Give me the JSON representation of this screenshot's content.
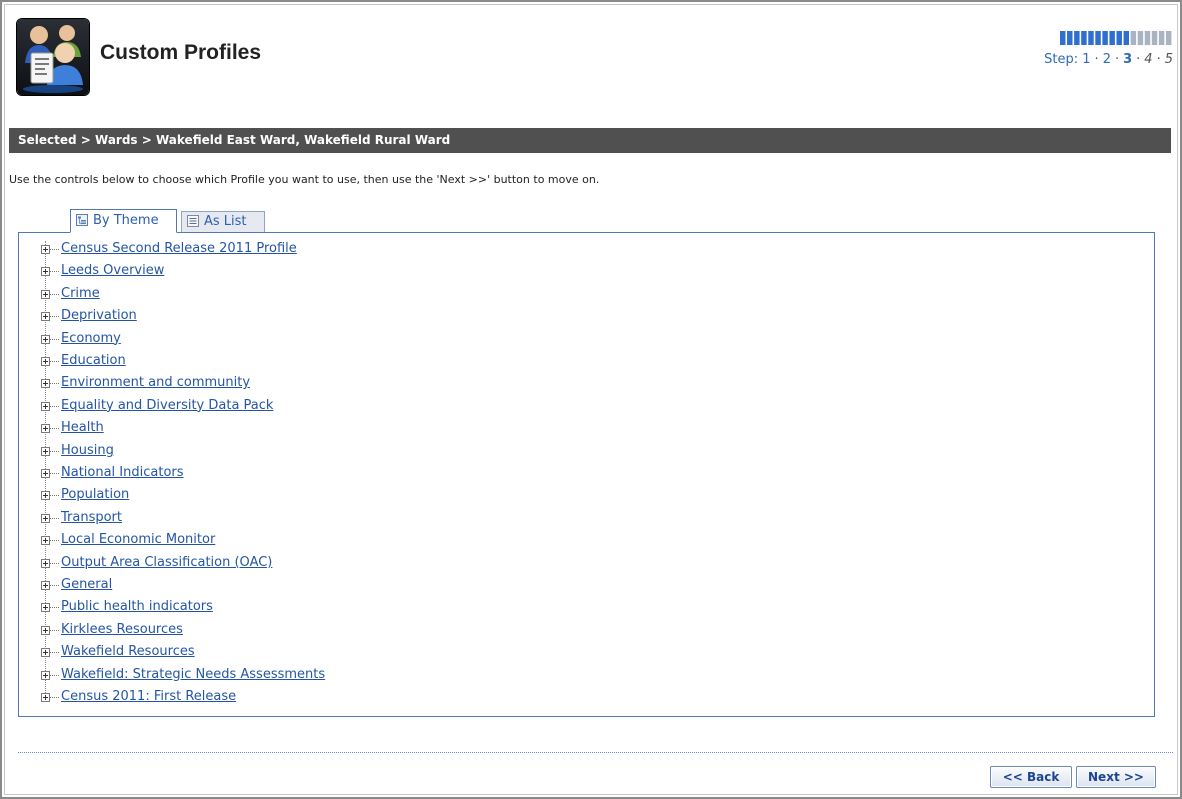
{
  "header": {
    "title": "Custom Profiles",
    "progress": {
      "filled": 10,
      "total": 16
    },
    "step_label": "Step:",
    "steps": [
      {
        "label": "1",
        "state": "done"
      },
      {
        "label": "2",
        "state": "done"
      },
      {
        "label": "3",
        "state": "current"
      },
      {
        "label": "4",
        "state": "future"
      },
      {
        "label": "5",
        "state": "future"
      }
    ]
  },
  "breadcrumb": "Selected > Wards > Wakefield East Ward, Wakefield Rural Ward",
  "instructions": "Use the controls below to choose which Profile you want to use, then use the 'Next >>' button to move on.",
  "tabs": [
    {
      "label": "By Theme",
      "active": true,
      "icon": "tree-icon"
    },
    {
      "label": "As List",
      "active": false,
      "icon": "list-icon"
    }
  ],
  "tree": [
    "Census Second Release 2011 Profile",
    "Leeds Overview",
    "Crime",
    "Deprivation",
    "Economy",
    "Education",
    "Environment and community",
    "Equality and Diversity Data Pack",
    "Health",
    "Housing",
    "National Indicators",
    "Population",
    "Transport",
    "Local Economic Monitor",
    "Output Area Classification (OAC)",
    "General",
    "Public health indicators",
    "Kirklees Resources",
    "Wakefield Resources",
    "Wakefield: Strategic Needs Assessments",
    "Census 2011: First Release"
  ],
  "buttons": {
    "back": "<< Back",
    "next": "Next >>"
  },
  "colors": {
    "link": "#2455a4",
    "breadcrumb_bg": "#505050",
    "step_filled": "#2f6fd0",
    "step_empty": "#a9b3c2"
  }
}
